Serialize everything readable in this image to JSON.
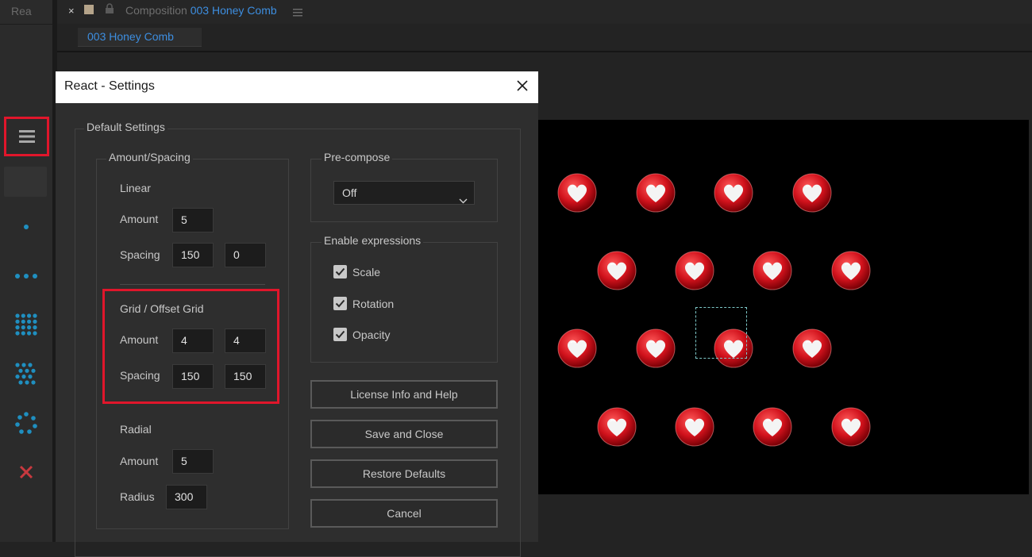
{
  "app": {
    "left_panel_tab": "Rea",
    "composition_label": "Composition",
    "composition_name": "003 Honey Comb",
    "composition_tab": "003 Honey Comb"
  },
  "dialog": {
    "title": "React - Settings",
    "default_settings_label": "Default Settings",
    "amount_spacing": {
      "label": "Amount/Spacing",
      "linear": {
        "heading": "Linear",
        "amount_label": "Amount",
        "amount": "5",
        "spacing_label": "Spacing",
        "spacing_x": "150",
        "spacing_y": "0"
      },
      "grid": {
        "heading": "Grid / Offset Grid",
        "amount_label": "Amount",
        "amount_x": "4",
        "amount_y": "4",
        "spacing_label": "Spacing",
        "spacing_x": "150",
        "spacing_y": "150"
      },
      "radial": {
        "heading": "Radial",
        "amount_label": "Amount",
        "amount": "5",
        "radius_label": "Radius",
        "radius": "300"
      }
    },
    "precompose": {
      "label": "Pre-compose",
      "selected": "Off"
    },
    "expressions": {
      "label": "Enable expressions",
      "items": [
        {
          "label": "Scale",
          "checked": true
        },
        {
          "label": "Rotation",
          "checked": true
        },
        {
          "label": "Opacity",
          "checked": true
        }
      ]
    },
    "buttons": {
      "license": "License Info and Help",
      "save": "Save and Close",
      "restore": "Restore Defaults",
      "cancel": "Cancel"
    }
  },
  "colors": {
    "highlight": "#e0162b",
    "accent_blue": "#3d8ee0",
    "tool_icon": "#1f8fc0"
  }
}
